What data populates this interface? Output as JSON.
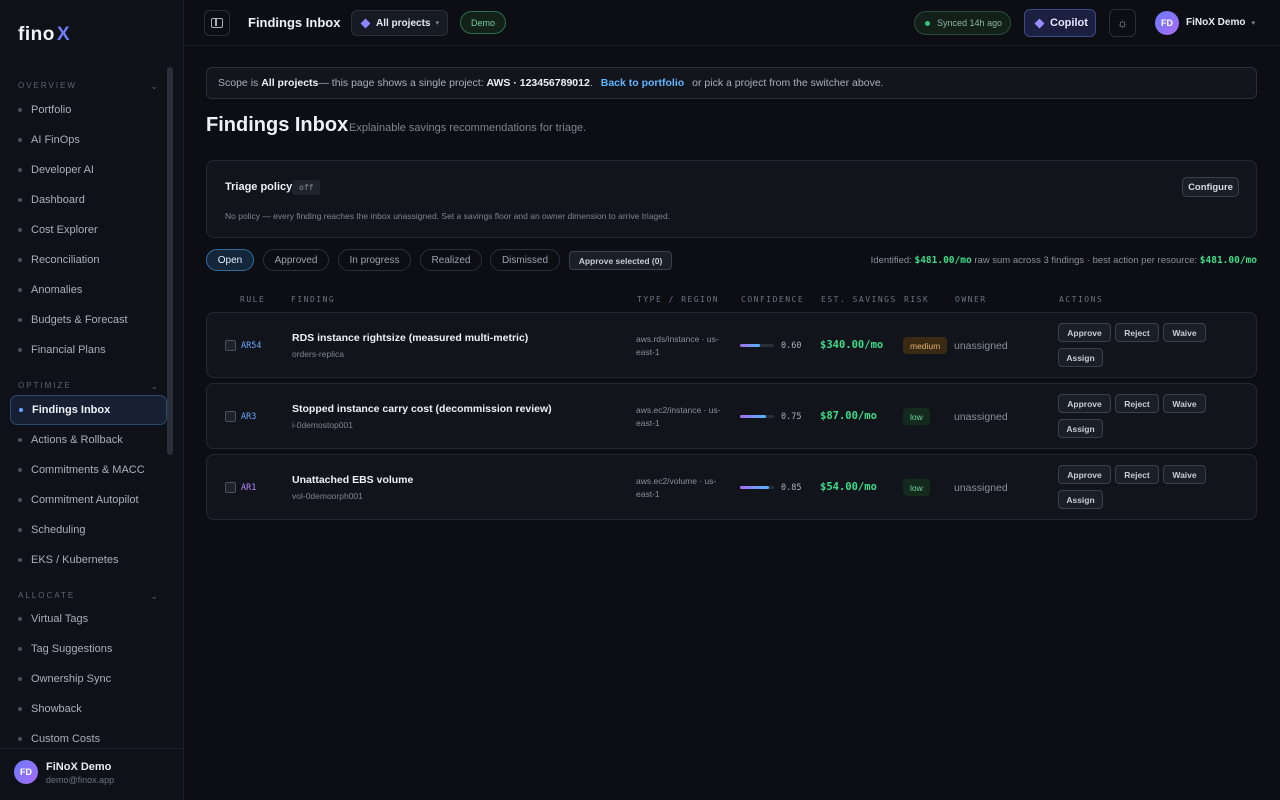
{
  "sidebar": {
    "logo_text": "fino",
    "logo_mark": "X",
    "sections": [
      {
        "title": "OVERVIEW",
        "items": [
          "Portfolio",
          "AI FinOps",
          "Developer AI",
          "Dashboard",
          "Cost Explorer",
          "Reconciliation",
          "Anomalies",
          "Budgets & Forecast",
          "Financial Plans"
        ]
      },
      {
        "title": "OPTIMIZE",
        "items": [
          "Findings Inbox",
          "Actions & Rollback",
          "Commitments & MACC",
          "Commitment Autopilot",
          "Scheduling",
          "EKS / Kubernetes"
        ]
      },
      {
        "title": "ALLOCATE",
        "items": [
          "Virtual Tags",
          "Tag Suggestions",
          "Ownership Sync",
          "Showback",
          "Custom Costs"
        ]
      }
    ],
    "active_item": "Findings Inbox",
    "user": {
      "initials": "FD",
      "name": "FiNoX Demo",
      "email": "demo@finox.app"
    }
  },
  "topbar": {
    "title": "Findings Inbox",
    "project_switcher": "All projects",
    "env_badge": "Demo",
    "sync_status": "Synced 14h ago",
    "copilot_label": "Copilot",
    "user_initials": "FD",
    "user_name": "FiNoX Demo"
  },
  "scope": {
    "prefix": "Scope is",
    "scope_value": "All projects",
    "middle": " — this page shows a single project:",
    "project": "AWS · 123456789012",
    "dot": ".",
    "link": "Back to portfolio",
    "suffix": "or pick a project from the switcher above."
  },
  "page": {
    "title": "Findings Inbox",
    "subtitle": "Explainable savings recommendations for triage."
  },
  "policy": {
    "title": "Triage policy",
    "status": "off",
    "description": "No policy — every finding reaches the inbox unassigned. Set a savings floor and an owner dimension to arrive triaged.",
    "configure_label": "Configure"
  },
  "tabs": [
    "Open",
    "Approved",
    "In progress",
    "Realized",
    "Dismissed"
  ],
  "active_tab": "Open",
  "approve_selected_label": "Approve selected (0)",
  "summary": {
    "label": "Identified:",
    "raw_amount": "$481.00/mo",
    "middle": "raw sum across 3 findings · best action per resource:",
    "best_amount": "$481.00/mo"
  },
  "table": {
    "columns": [
      "RULE",
      "FINDING",
      "TYPE / REGION",
      "CONFIDENCE",
      "EST. SAVINGS",
      "RISK",
      "OWNER",
      "ACTIONS"
    ],
    "actions": [
      "Approve",
      "Reject",
      "Waive",
      "Assign"
    ],
    "rows": [
      {
        "rule": "AR54",
        "finding": "RDS instance rightsize (measured multi-metric)",
        "resource": "orders-replica",
        "type": "aws.rds/instance · us-east-1",
        "confidence": 0.6,
        "confidence_label": "0.60",
        "savings": "$340.00/mo",
        "risk": "medium",
        "owner": "unassigned"
      },
      {
        "rule": "AR3",
        "finding": "Stopped instance carry cost (decommission review)",
        "resource": "i-0demostop001",
        "type": "aws.ec2/instance · us-east-1",
        "confidence": 0.75,
        "confidence_label": "0.75",
        "savings": "$87.00/mo",
        "risk": "low",
        "owner": "unassigned"
      },
      {
        "rule": "AR1",
        "finding": "Unattached EBS volume",
        "resource": "vol-0demoorph001",
        "type": "aws.ec2/volume · us-east-1",
        "confidence": 0.85,
        "confidence_label": "0.85",
        "savings": "$54.00/mo",
        "risk": "low",
        "owner": "unassigned"
      }
    ]
  },
  "colors": {
    "accent": "#6aa6ff",
    "savings": "#3ddc8a",
    "brand": "#6f7cf8"
  }
}
